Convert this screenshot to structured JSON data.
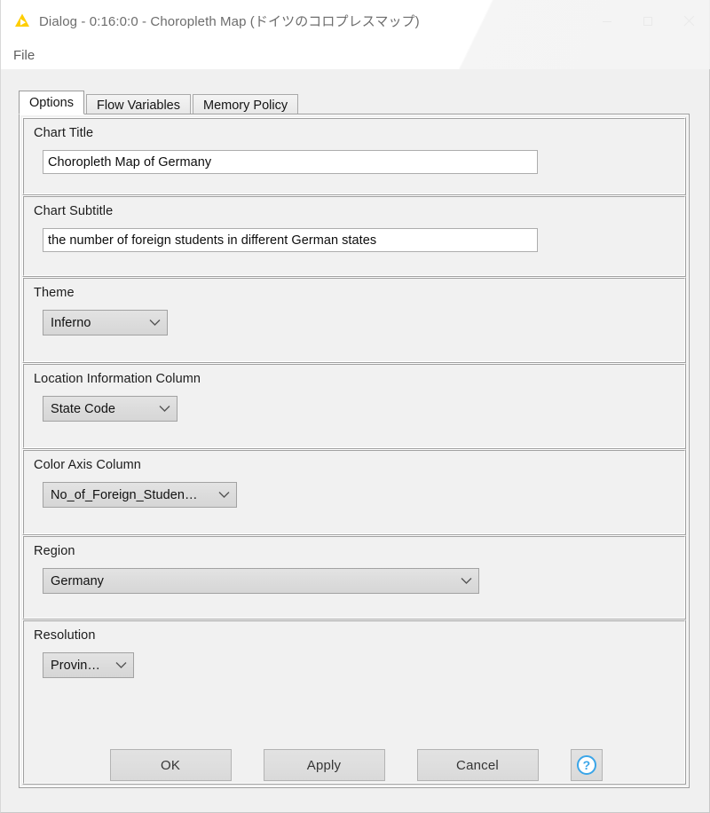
{
  "window": {
    "title": "Dialog - 0:16:0:0 - Choropleth Map (ドイツのコロプレスマップ)",
    "app_icon": "knime-triangle-icon",
    "controls": {
      "minimize": "minimize-icon",
      "maximize": "maximize-icon",
      "close": "close-icon"
    }
  },
  "menubar": {
    "items": [
      {
        "label": "File"
      }
    ]
  },
  "tabs": [
    {
      "label": "Options",
      "selected": true
    },
    {
      "label": "Flow Variables",
      "selected": false
    },
    {
      "label": "Memory Policy",
      "selected": false
    }
  ],
  "options": {
    "chart_title": {
      "label": "Chart Title",
      "value": "Choropleth Map of Germany",
      "placeholder": ""
    },
    "chart_subtitle": {
      "label": "Chart Subtitle",
      "value": "the number of foreign students in different German states",
      "placeholder": ""
    },
    "theme": {
      "label": "Theme",
      "value": "Inferno"
    },
    "location_column": {
      "label": "Location Information Column",
      "value": "State Code"
    },
    "color_axis_column": {
      "label": "Color Axis Column",
      "value": "No_of_Foreign_Studen…"
    },
    "region": {
      "label": "Region",
      "value": "Germany"
    },
    "resolution": {
      "label": "Resolution",
      "value": "Provin…"
    }
  },
  "buttons": {
    "ok": "OK",
    "apply": "Apply",
    "cancel": "Cancel",
    "help": "help-icon"
  },
  "colors": {
    "accent_icon": "#FFCE00",
    "help_blue": "#3AA5E8",
    "window_bg": "#F0F0F0",
    "panel_bg": "#F1F1F1",
    "field_bg": "#FFFFFF"
  }
}
